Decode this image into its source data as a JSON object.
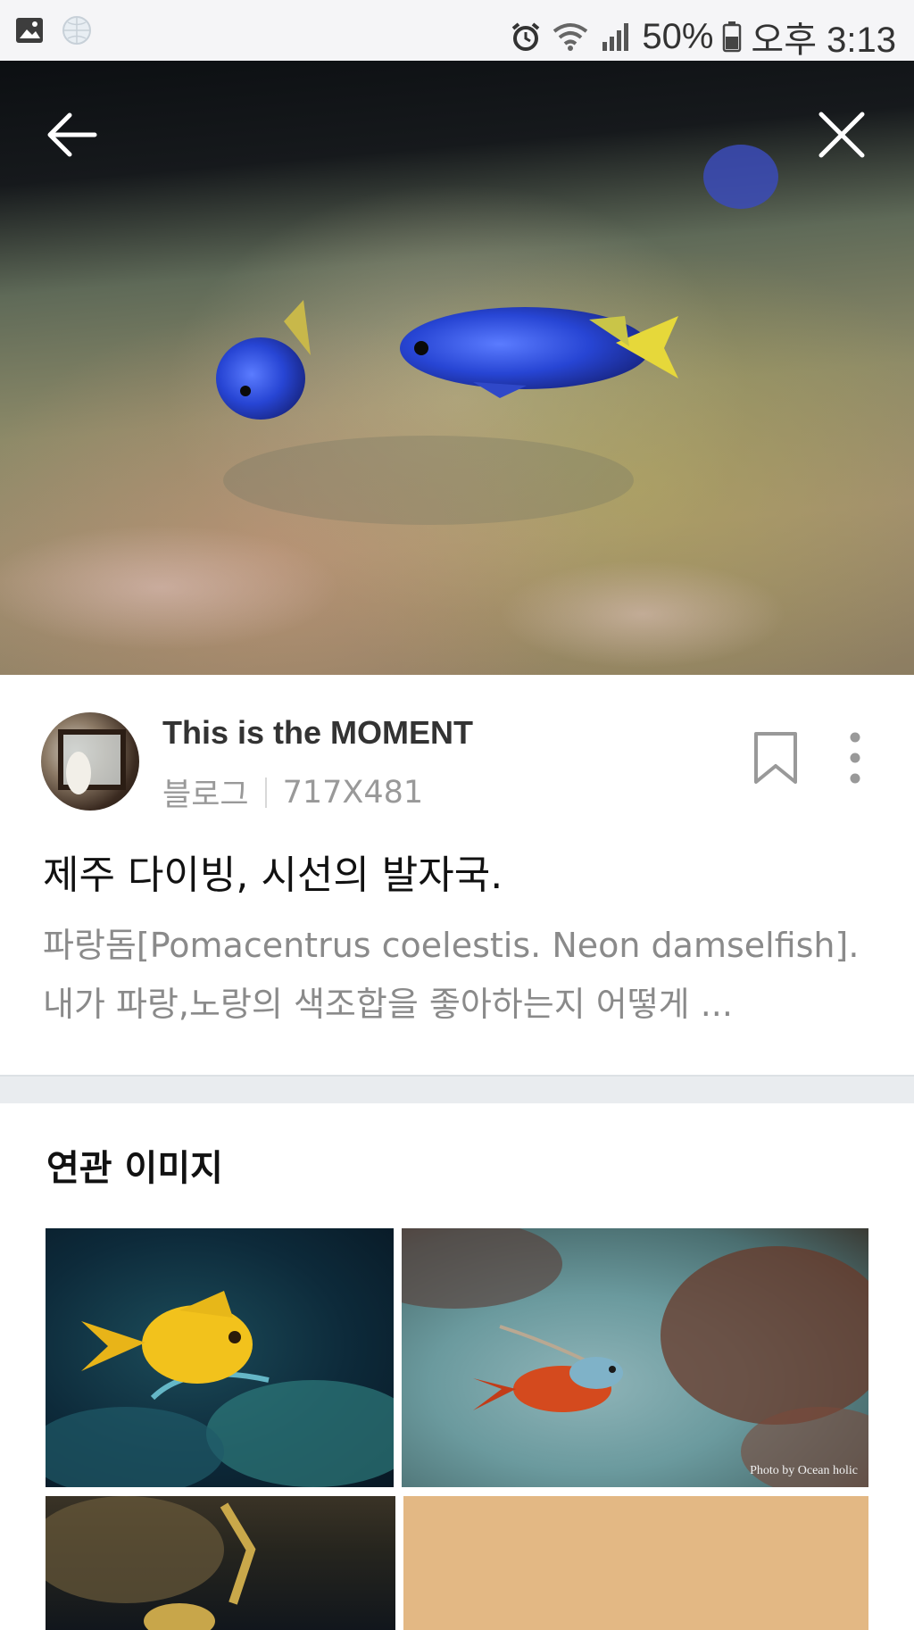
{
  "status_bar": {
    "battery_percent": "50%",
    "time": "오후 3:13",
    "icons": [
      "gallery-icon",
      "globe-icon",
      "alarm-icon",
      "wifi-icon",
      "signal-icon",
      "battery-icon"
    ]
  },
  "hero": {
    "back_icon": "arrow-left-icon",
    "close_icon": "close-icon"
  },
  "source": {
    "blog_name": "This is the MOMENT",
    "type": "블로그",
    "dimensions": "717X481"
  },
  "post": {
    "title": "제주 다이빙, 시선의 발자국.",
    "description": "파랑돔[Pomacentrus coelestis. Neon damselfish]. 내가 파랑,노랑의 색조합을 좋아하는지 어떻게 ..."
  },
  "related": {
    "heading": "연관 이미지",
    "items": [
      {
        "watermark": ""
      },
      {
        "watermark": "Photo by Ocean holic"
      },
      {
        "watermark": ""
      },
      {
        "watermark": ""
      }
    ]
  },
  "colors": {
    "status_bg": "#f5f5f7",
    "divider": "#e9ecef",
    "muted_text": "#8a8a8a",
    "placeholder_tan": "#e3b884"
  }
}
